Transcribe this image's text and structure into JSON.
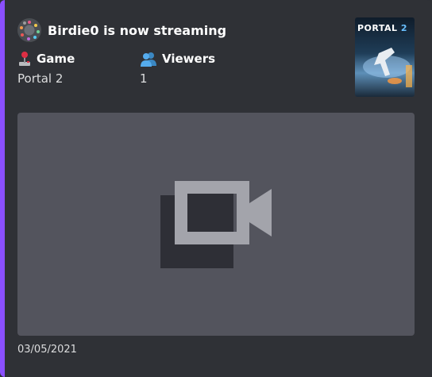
{
  "author": {
    "name": "Birdie0 is now streaming"
  },
  "fields": [
    {
      "name": "Game",
      "value": "Portal 2",
      "icon": "joystick-icon"
    },
    {
      "name": "Viewers",
      "value": "1",
      "icon": "busts-icon"
    }
  ],
  "thumbnail": {
    "title": "PORTAL",
    "title_number": "2"
  },
  "video": {
    "icon": "video-camera-icon"
  },
  "footer": {
    "date": "03/05/2021"
  },
  "colors": {
    "accent": "#8a4fff",
    "embed_bg": "#2f3136",
    "video_bg": "#53545d",
    "text": "#dcddde",
    "heading": "#ffffff"
  }
}
